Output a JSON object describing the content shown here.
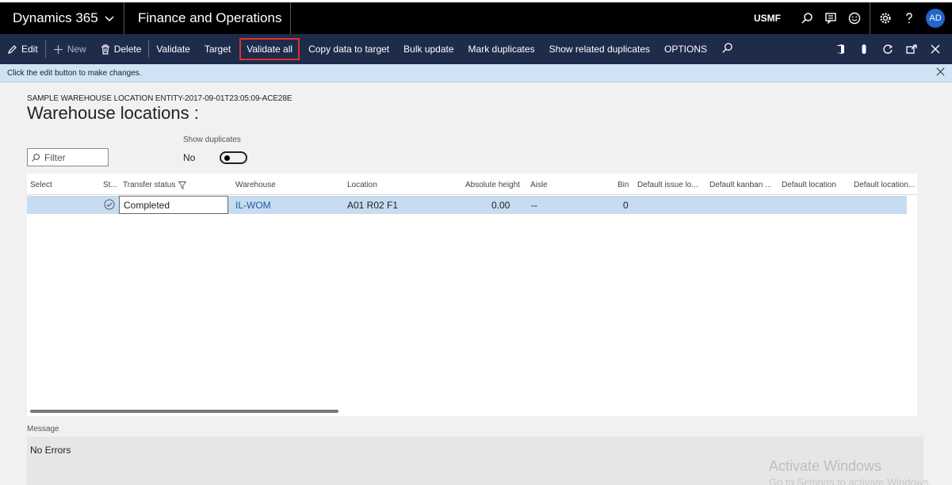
{
  "topbar": {
    "brand": "Dynamics 365",
    "module": "Finance and Operations",
    "company": "USMF",
    "avatar_initials": "AD"
  },
  "actions": {
    "edit": "Edit",
    "new": "New",
    "delete": "Delete",
    "validate": "Validate",
    "target": "Target",
    "validate_all": "Validate all",
    "copy_data": "Copy data to target",
    "bulk_update": "Bulk update",
    "mark_duplicates": "Mark duplicates",
    "show_related": "Show related duplicates",
    "options": "OPTIONS"
  },
  "banner": {
    "text": "Click the edit button to make changes."
  },
  "page": {
    "caption": "SAMPLE WAREHOUSE LOCATION ENTITY-2017-09-01T23:05:09-ACE28E",
    "title": "Warehouse locations :",
    "show_duplicates_label": "Show duplicates",
    "show_duplicates_value": "No",
    "filter_placeholder": "Filter"
  },
  "grid": {
    "columns": [
      "Select",
      "St...",
      "Transfer status",
      "Warehouse",
      "Location",
      "Absolute height",
      "Aisle",
      "Bin",
      "Default issue lo...",
      "Default kanban ...",
      "Default location",
      "Default location..."
    ],
    "rows": [
      {
        "transfer_status": "Completed",
        "warehouse": "IL-WOM",
        "location": "A01 R02 F1",
        "absolute_height": "0.00",
        "aisle": "--",
        "bin": "0"
      }
    ]
  },
  "message": {
    "label": "Message",
    "text": "No Errors"
  },
  "watermark": {
    "line1": "Activate Windows",
    "line2": "Go to Settings to activate Windows."
  },
  "colors": {
    "actionbar": "#1e2b4a",
    "highlight_border": "#e03030",
    "selected_row": "#c7dcf0",
    "link": "#1f5aa8"
  }
}
